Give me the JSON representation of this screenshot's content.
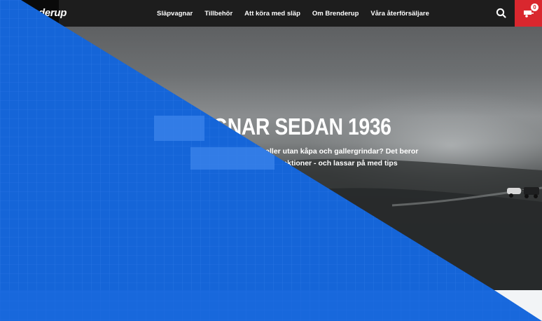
{
  "brand": {
    "logo_text": "Brenderup"
  },
  "nav": {
    "items": [
      {
        "label": "Släpvagnar"
      },
      {
        "label": "Tillbehör"
      },
      {
        "label": "Att köra med släp"
      },
      {
        "label": "Om Brenderup"
      },
      {
        "label": "Våra återförsäljare"
      }
    ]
  },
  "icons": {
    "search": "search-icon",
    "cart": "cart-icon"
  },
  "cart": {
    "count": "0"
  },
  "hero": {
    "title_visible": "AGNAR SEDAN 1936",
    "text_line1": "nt? Med eller utan kåpa och gallergrindar? Det beror",
    "text_line2": "ssa smarta funktioner - och lassar på med tips"
  },
  "colors": {
    "nav_background": "#1d1d1d",
    "logo_background": "#0a0a0a",
    "cart_accent": "#d9272e",
    "overlay_blue": "#1565d8"
  }
}
